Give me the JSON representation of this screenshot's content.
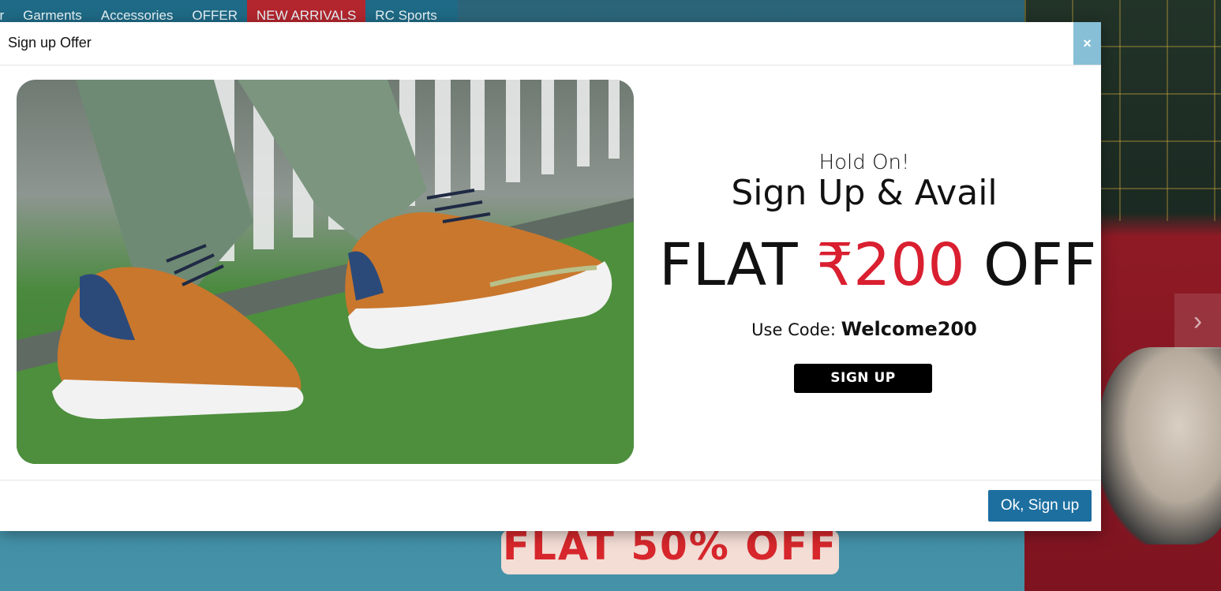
{
  "background": {
    "nav_items": [
      {
        "label": "ar"
      },
      {
        "label": "Garments"
      },
      {
        "label": "Accessories"
      },
      {
        "label": "OFFER"
      },
      {
        "label": "NEW ARRIVALS",
        "highlight": true
      },
      {
        "label": "RC Sports"
      }
    ],
    "banner_text": "FLAT 50% OFF",
    "carousel_next_icon": "chevron-right-icon"
  },
  "modal": {
    "title": "Sign up Offer",
    "close_label": "×",
    "promo": {
      "line1": "Hold On!",
      "line2": "Sign Up & Avail",
      "flat_prefix": "FLAT ",
      "amount": "₹200",
      "flat_suffix": " OFF",
      "code_label": "Use Code: ",
      "code": "Welcome200",
      "signup_label": "SIGN UP"
    },
    "ok_label": "Ok, Sign up"
  },
  "colors": {
    "accent_red": "#d91f30",
    "primary_button": "#1d6fa0",
    "close_button": "#86bfd6"
  }
}
